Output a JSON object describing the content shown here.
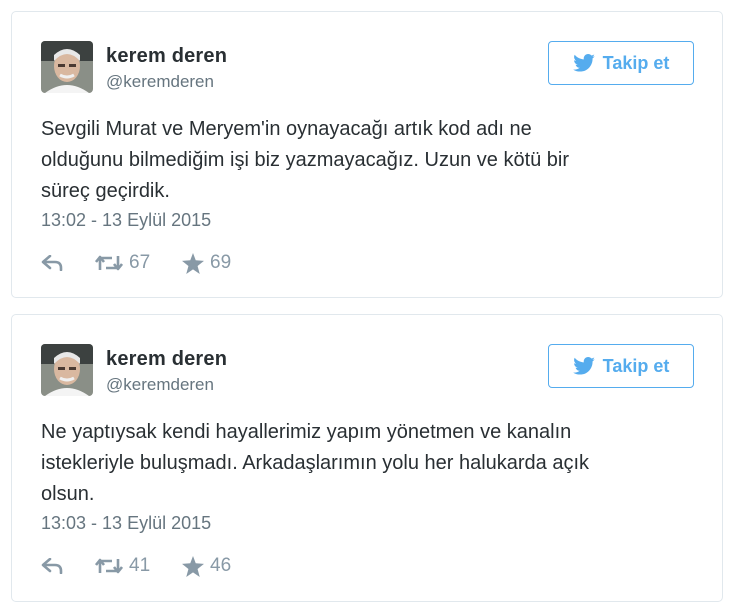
{
  "tweets": [
    {
      "author_name": "kerem deren",
      "author_handle": "@keremderen",
      "follow_label": "Takip et",
      "text": "Sevgili Murat ve Meryem'in oynayacağı artık kod adı ne\nolduğunu bilmediğim işi biz yazmayacağız.  Uzun ve kötü bir\nsüreç geçirdik.",
      "timestamp": "13:02 - 13 Eylül 2015",
      "retweet_count": "67",
      "like_count": "69"
    },
    {
      "author_name": "kerem deren",
      "author_handle": "@keremderen",
      "follow_label": "Takip et",
      "text": "Ne yaptıysak kendi hayallerimiz yapım yönetmen ve kanalın\nistekleriyle buluşmadı. Arkadaşlarımın yolu her halukarda açık\nolsun.",
      "timestamp": "13:03 - 13 Eylül 2015",
      "retweet_count": "41",
      "like_count": "46"
    }
  ],
  "icons": {
    "brand": "bird-icon",
    "reply": "reply-icon",
    "retweet": "retweet-icon",
    "like": "star-icon"
  },
  "colors": {
    "accent": "#55acee",
    "text": "#292f33",
    "muted": "#66757f",
    "action": "#8899a6",
    "border": "#e1e8ed"
  }
}
